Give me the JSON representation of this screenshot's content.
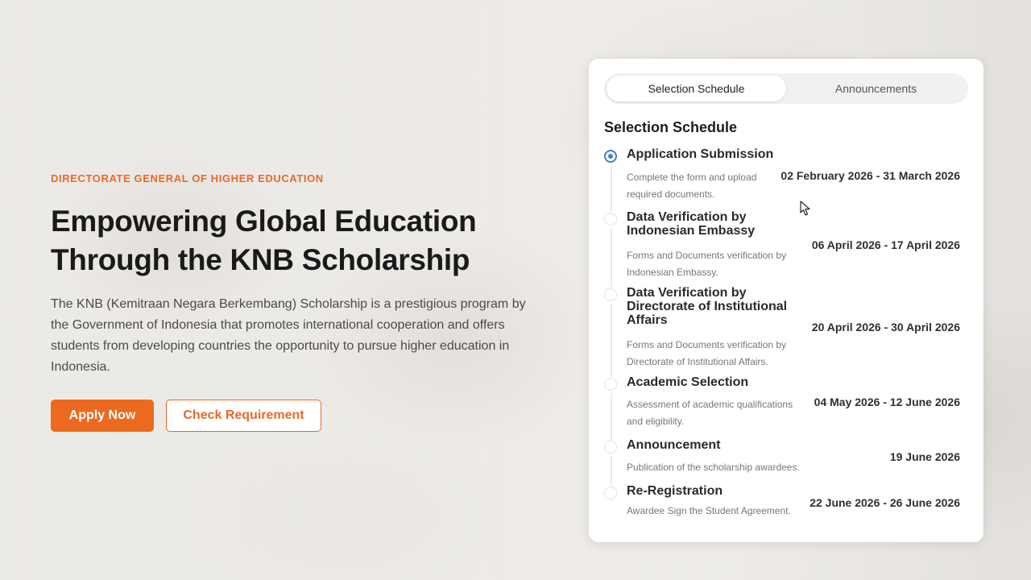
{
  "hero": {
    "eyebrow": "DIRECTORATE GENERAL OF HIGHER EDUCATION",
    "headline_line1": "Empowering Global Education",
    "headline_line2": "Through the KNB Scholarship",
    "description": "The KNB (Kemitraan Negara Berkembang) Scholarship is a prestigious program by the Government of Indonesia that promotes international cooperation and offers students from developing countries the opportunity to pursue higher education in Indonesia.",
    "apply_label": "Apply Now",
    "check_label": "Check Requirement"
  },
  "panel": {
    "tabs": [
      {
        "label": "Selection Schedule",
        "active": true
      },
      {
        "label": "Announcements",
        "active": false
      }
    ],
    "title": "Selection Schedule",
    "items": [
      {
        "title": "Application Submission",
        "desc": "Complete the form and upload required documents.",
        "date": "02 February 2026 - 31 March 2026",
        "active": true
      },
      {
        "title": "Data Verification by Indonesian Embassy",
        "desc": "Forms and Documents verification by Indonesian Embassy.",
        "date": "06 April 2026 - 17 April 2026",
        "active": false
      },
      {
        "title": "Data Verification by Directorate of Institutional Affairs",
        "desc": "Forms and Documents verification by Directorate of Institutional Affairs.",
        "date": "20 April 2026 - 30 April 2026",
        "active": false
      },
      {
        "title": "Academic Selection",
        "desc": "Assessment of academic qualifications and eligibility.",
        "date": "04 May 2026 - 12 June 2026",
        "active": false
      },
      {
        "title": "Announcement",
        "desc": "Publication of the scholarship awardees.",
        "date": "19 June 2026",
        "active": false
      },
      {
        "title": "Re-Registration",
        "desc": "Awardee Sign the Student Agreement.",
        "date": "22 June 2026 - 26 June 2026",
        "active": false
      }
    ]
  },
  "colors": {
    "accent": "#ec6a1f",
    "active_dot": "#3b82c4"
  }
}
